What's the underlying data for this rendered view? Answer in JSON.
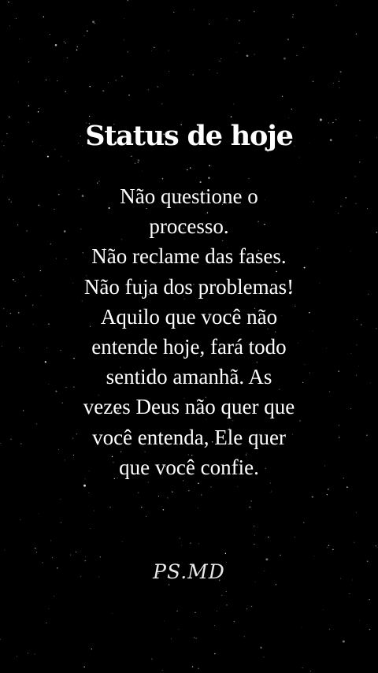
{
  "title": "Status de hoje",
  "message_lines": [
    "Não questione o",
    "processo.",
    "Não reclame das fases.",
    "Não fuja dos problemas!",
    "Aquilo que você não",
    "entende hoje, fará todo",
    "sentido amanhã. As",
    "vezes Deus não quer que",
    "você entenda, Ele quer",
    "que você confie."
  ],
  "signature": "PS.MD",
  "colors": {
    "background": "#000000",
    "text": "#ffffff",
    "stars": "#ffffff"
  }
}
